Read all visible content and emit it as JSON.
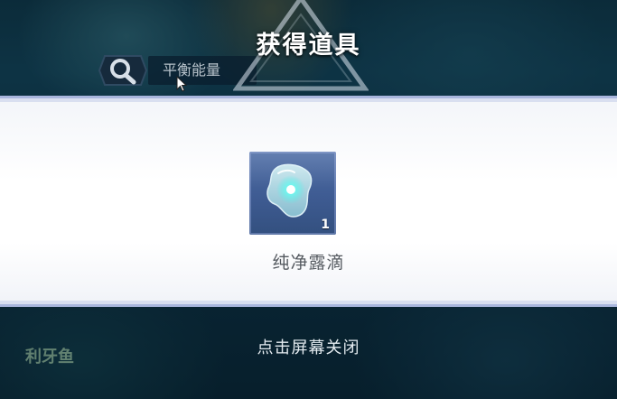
{
  "header": {
    "title": "获得道具"
  },
  "background_ui": {
    "search": {
      "icon": "search-icon",
      "value": "平衡能量"
    },
    "corner_label": "利牙鱼"
  },
  "reward": {
    "items": [
      {
        "name": "纯净露滴",
        "count": "1",
        "icon": "dewdrop-icon"
      }
    ]
  },
  "footer": {
    "hint": "点击屏幕关闭"
  },
  "colors": {
    "panel_border": "#a9b6dd",
    "item_card": "#3e5b92",
    "dew_glow": "#4ff0e8",
    "title_text": "#ffffff"
  }
}
